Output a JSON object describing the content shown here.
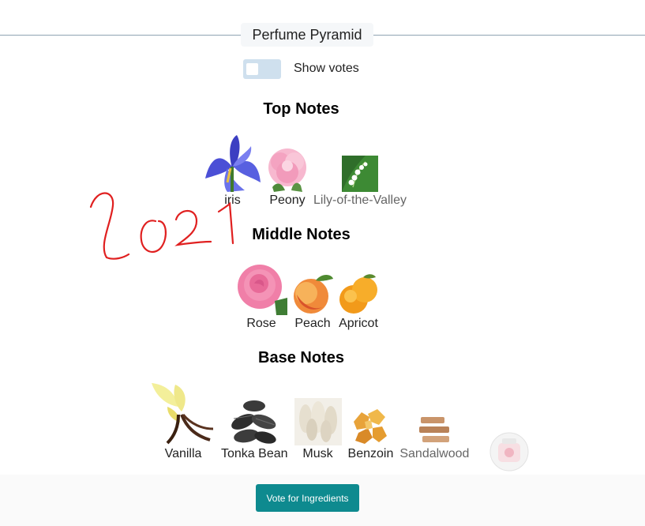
{
  "header": {
    "title": "Perfume Pyramid"
  },
  "toggle": {
    "label": "Show votes",
    "checked": false
  },
  "sections": {
    "top": {
      "title": "Top Notes",
      "notes": [
        {
          "label": "iris",
          "icon": "iris-flower"
        },
        {
          "label": "Peony",
          "icon": "peony-flower"
        },
        {
          "label": "Lily-of-the-Valley",
          "icon": "lily-of-the-valley"
        }
      ]
    },
    "middle": {
      "title": "Middle Notes",
      "notes": [
        {
          "label": "Rose",
          "icon": "rose-flower"
        },
        {
          "label": "Peach",
          "icon": "peach-fruit"
        },
        {
          "label": "Apricot",
          "icon": "apricot-fruit"
        }
      ]
    },
    "base": {
      "title": "Base Notes",
      "notes": [
        {
          "label": "Vanilla",
          "icon": "vanilla-flower"
        },
        {
          "label": "Tonka Bean",
          "icon": "tonka-beans"
        },
        {
          "label": "Musk",
          "icon": "musk"
        },
        {
          "label": "Benzoin",
          "icon": "benzoin-resin"
        },
        {
          "label": "Sandalwood",
          "icon": "sandalwood-sticks"
        }
      ]
    }
  },
  "annotation": {
    "text": "2021",
    "color": "#e02020"
  },
  "footer": {
    "vote_label": "Vote for Ingredients"
  },
  "colors": {
    "accent": "#0e8a8f",
    "toggle": "#cfe0ee",
    "divider": "#8fa4b3"
  }
}
